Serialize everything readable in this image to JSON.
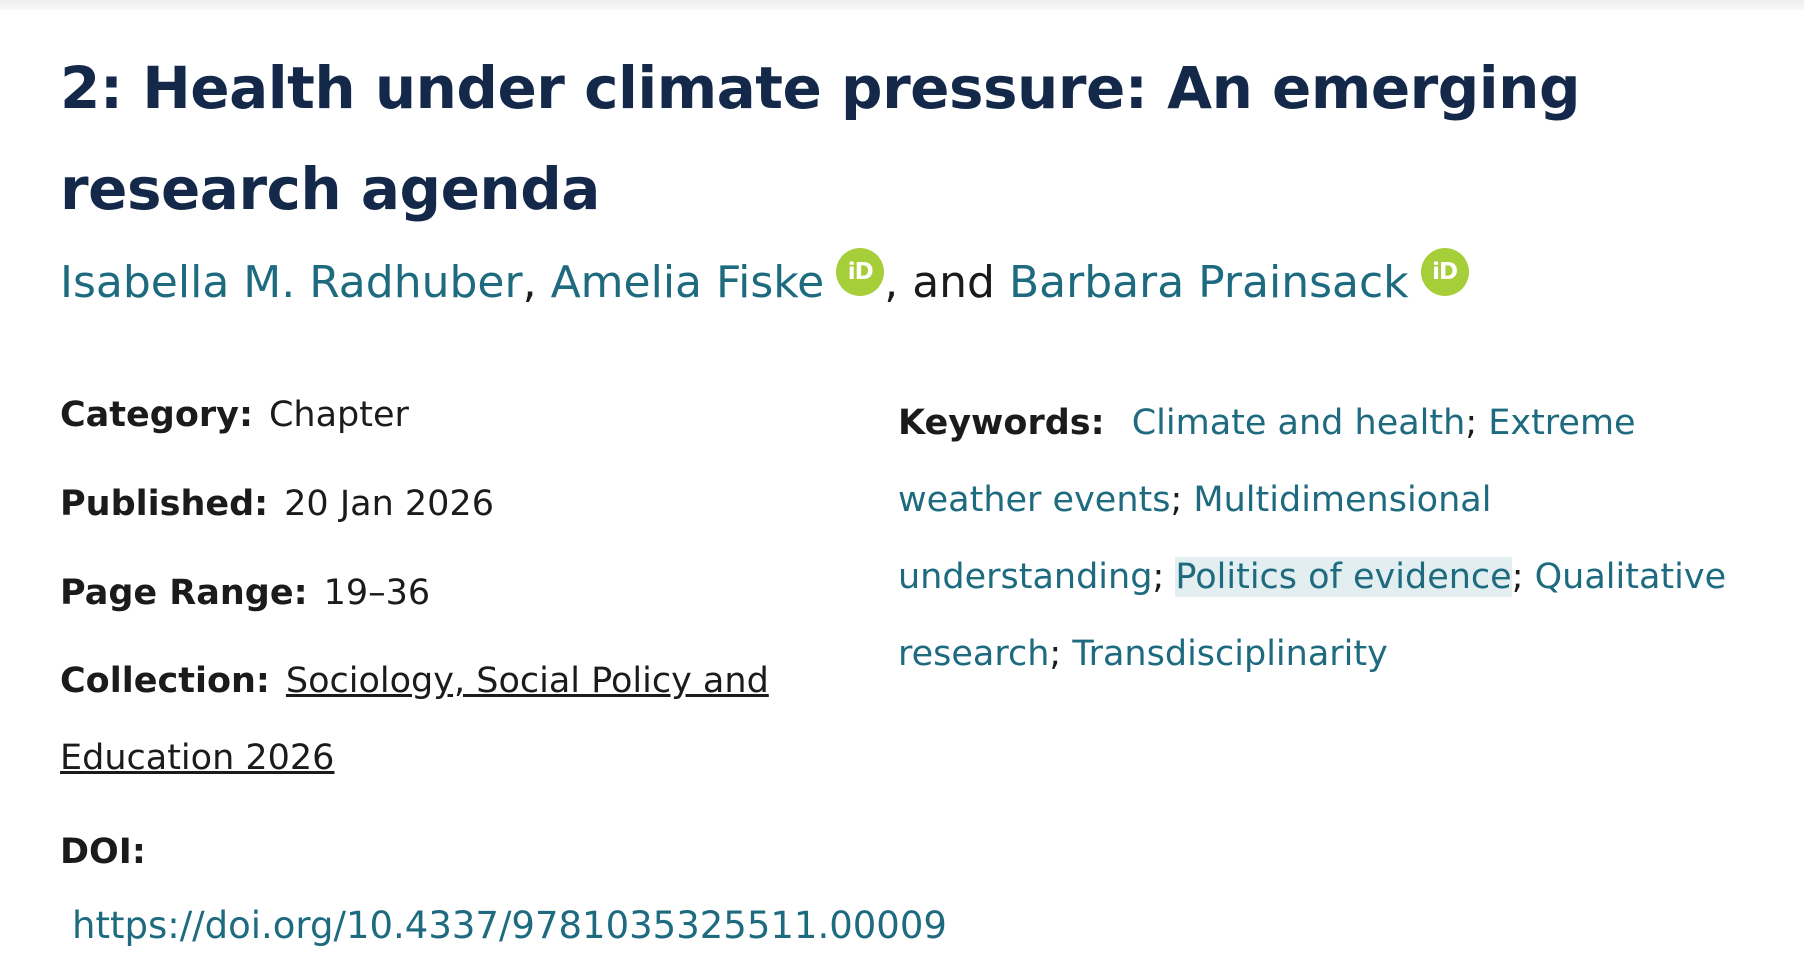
{
  "chapter": {
    "title": "2: Health under climate pressure: An emerging research agenda"
  },
  "authors": [
    {
      "name": "Isabella M. Radhuber",
      "orcid": false
    },
    {
      "name": "Amelia Fiske",
      "orcid": true
    },
    {
      "name": "Barbara Prainsack",
      "orcid": true
    }
  ],
  "authors_separators": {
    "comma": ",",
    "and": ", and"
  },
  "orcid_icon": {
    "icon": "orcid-icon",
    "glyph": "iD",
    "color": "#a6ce39"
  },
  "meta": {
    "category_label": "Category:",
    "category_value": "Chapter",
    "published_label": "Published:",
    "published_value": "20 Jan 2026",
    "page_range_label": "Page Range:",
    "page_range_value": "19–36",
    "collection_label": "Collection:",
    "collection_value": "Sociology, Social Policy and Education 2026",
    "doi_label": "DOI:",
    "doi_value": "https://doi.org/10.4337/9781035325511.00009"
  },
  "keywords": {
    "label": "Keywords:",
    "items": [
      "Climate and health",
      "Extreme weather events",
      "Multidimensional understanding",
      "Politics of evidence",
      "Qualitative research",
      "Transdisciplinarity"
    ],
    "separator": ";"
  },
  "colors": {
    "title": "#14294a",
    "link": "#1e6b80",
    "text": "#1b1b1b",
    "highlight": "#e3eef1"
  }
}
